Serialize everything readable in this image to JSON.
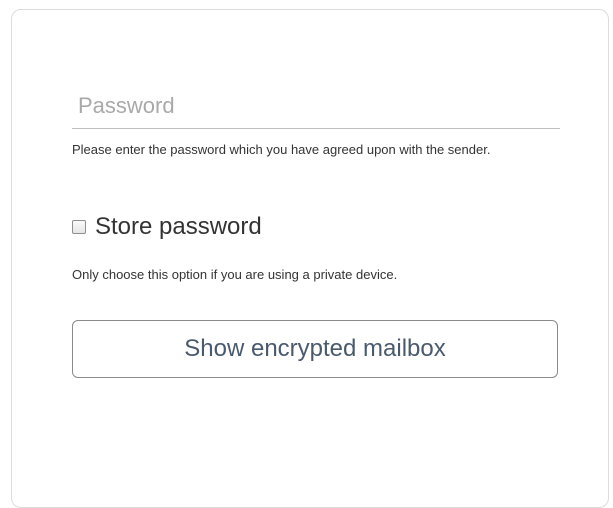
{
  "password": {
    "placeholder": "Password",
    "value": "",
    "help": "Please enter the password which you have agreed upon with the sender."
  },
  "store_password": {
    "label": "Store password",
    "checked": false,
    "help": "Only choose this option if you are using a private device."
  },
  "show_button": {
    "label": "Show encrypted mailbox"
  },
  "colors": {
    "button_text": "#4a5a6e",
    "placeholder": "#a9a9a9",
    "card_border": "#dcdcdc"
  },
  "icons": {
    "checkbox": "checkbox-unchecked-icon"
  }
}
